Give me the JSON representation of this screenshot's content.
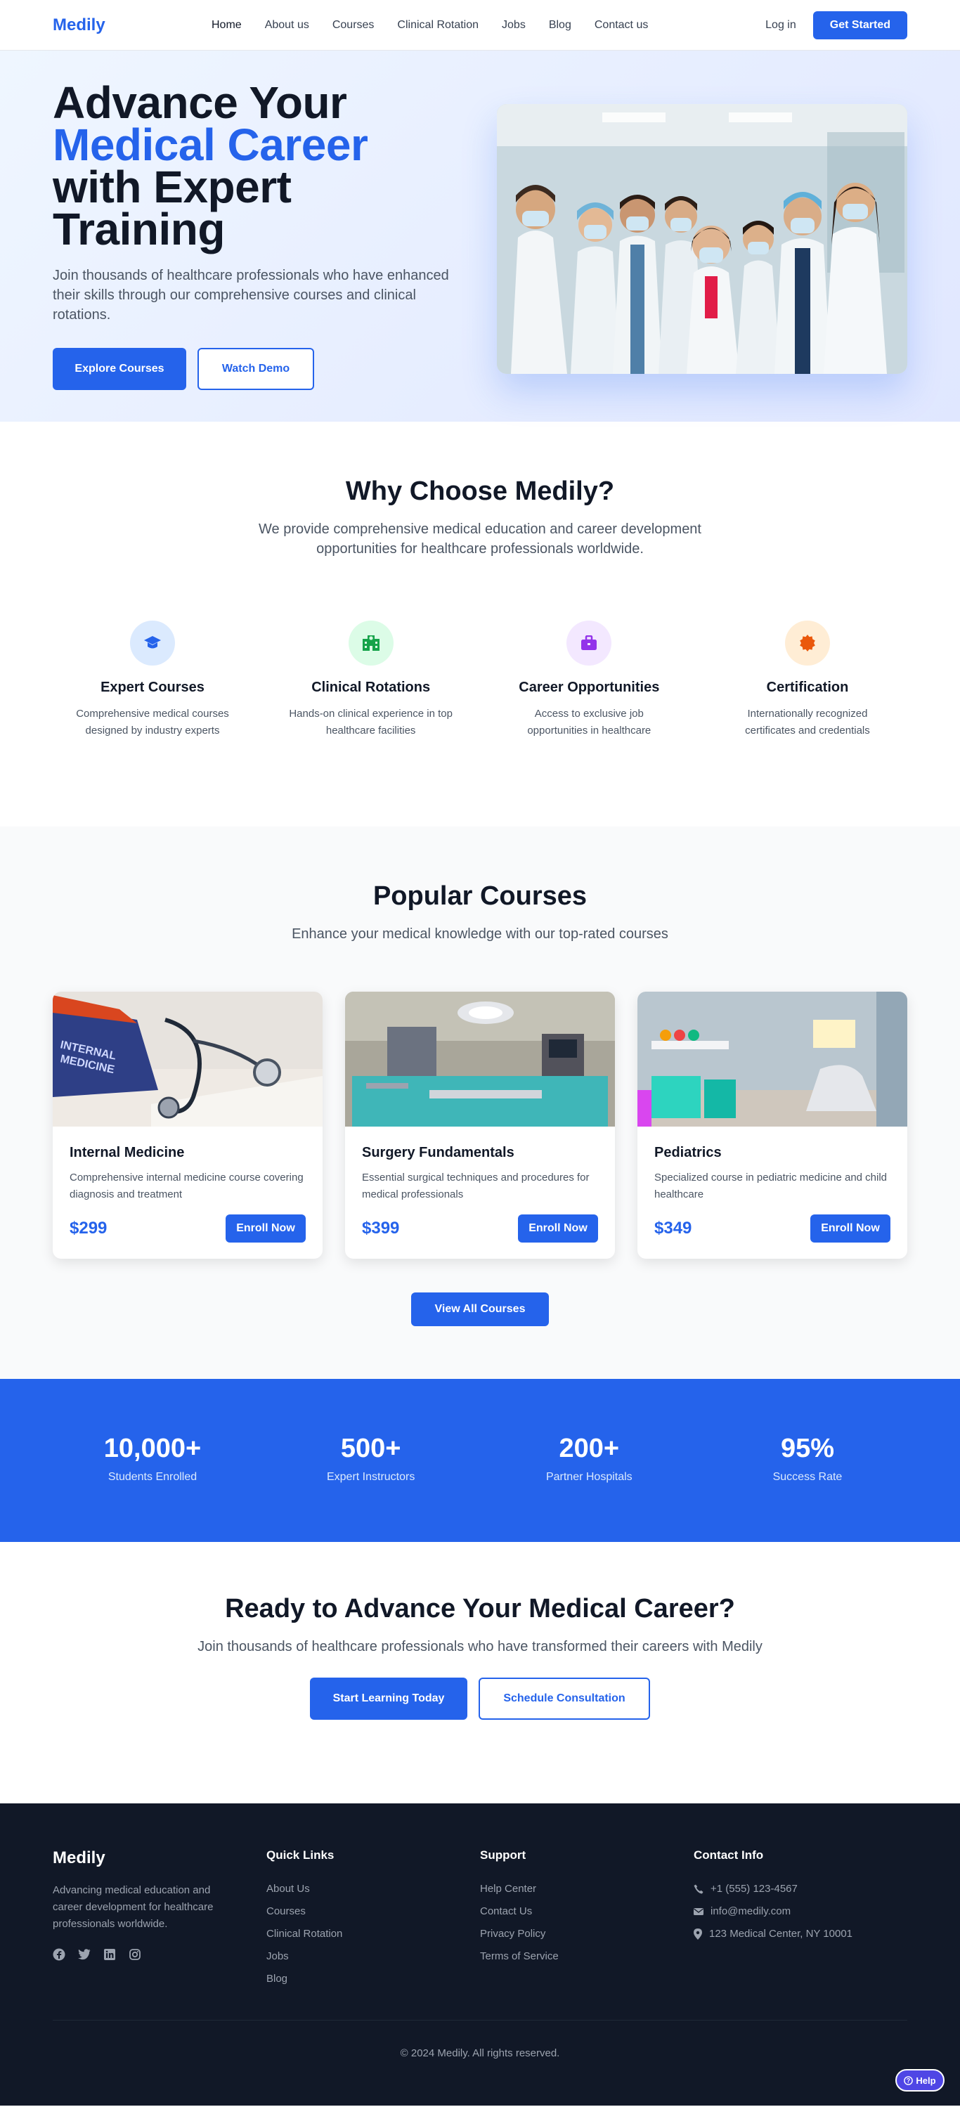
{
  "nav": {
    "logo": "Medily",
    "links": [
      "Home",
      "About us",
      "Courses",
      "Clinical Rotation",
      "Jobs",
      "Blog",
      "Contact us"
    ],
    "login": "Log in",
    "cta": "Get Started"
  },
  "hero": {
    "title_line1": "Advance Your",
    "title_accent": "Medical Career",
    "title_line2": "with Expert",
    "title_line3": "Training",
    "subtitle": "Join thousands of healthcare professionals who have enhanced their skills through our comprehensive courses and clinical rotations.",
    "primary_button": "Explore Courses",
    "secondary_button": "Watch Demo"
  },
  "why": {
    "title": "Why Choose Medily?",
    "subtitle": "We provide comprehensive medical education and career development opportunities for healthcare professionals worldwide.",
    "features": [
      {
        "icon": "graduation-cap-icon",
        "title": "Expert Courses",
        "desc": "Comprehensive medical courses designed by industry experts",
        "color": "#2563eb",
        "bg": "#dbeafe"
      },
      {
        "icon": "hospital-icon",
        "title": "Clinical Rotations",
        "desc": "Hands-on clinical experience in top healthcare facilities",
        "color": "#16a34a",
        "bg": "#dcfce7"
      },
      {
        "icon": "briefcase-icon",
        "title": "Career Opportunities",
        "desc": "Access to exclusive job opportunities in healthcare",
        "color": "#9333ea",
        "bg": "#f3e8ff"
      },
      {
        "icon": "certificate-icon",
        "title": "Certification",
        "desc": "Internationally recognized certificates and credentials",
        "color": "#ea580c",
        "bg": "#ffedd5"
      }
    ]
  },
  "courses": {
    "title": "Popular Courses",
    "subtitle": "Enhance your medical knowledge with our top-rated courses",
    "items": [
      {
        "title": "Internal Medicine",
        "desc": "Comprehensive internal medicine course covering diagnosis and treatment",
        "price": "$299",
        "button": "Enroll Now"
      },
      {
        "title": "Surgery Fundamentals",
        "desc": "Essential surgical techniques and procedures for medical professionals",
        "price": "$399",
        "button": "Enroll Now"
      },
      {
        "title": "Pediatrics",
        "desc": "Specialized course in pediatric medicine and child healthcare",
        "price": "$349",
        "button": "Enroll Now"
      }
    ],
    "view_all": "View All Courses"
  },
  "stats": [
    {
      "value": "10,000+",
      "label": "Students Enrolled"
    },
    {
      "value": "500+",
      "label": "Expert Instructors"
    },
    {
      "value": "200+",
      "label": "Partner Hospitals"
    },
    {
      "value": "95%",
      "label": "Success Rate"
    }
  ],
  "cta": {
    "title": "Ready to Advance Your Medical Career?",
    "subtitle": "Join thousands of healthcare professionals who have transformed their careers with Medily",
    "primary_button": "Start Learning Today",
    "secondary_button": "Schedule Consultation"
  },
  "footer": {
    "logo": "Medily",
    "about": "Advancing medical education and career development for healthcare professionals worldwide.",
    "socials": [
      "facebook-icon",
      "twitter-icon",
      "linkedin-icon",
      "instagram-icon"
    ],
    "quick_links_title": "Quick Links",
    "quick_links": [
      "About Us",
      "Courses",
      "Clinical Rotation",
      "Jobs",
      "Blog"
    ],
    "support_title": "Support",
    "support_links": [
      "Help Center",
      "Contact Us",
      "Privacy Policy",
      "Terms of Service"
    ],
    "contact_title": "Contact Info",
    "phone": "+1 (555) 123-4567",
    "email": "info@medily.com",
    "address": "123 Medical Center, NY 10001",
    "copyright": "© 2024 Medily. All rights reserved."
  },
  "help_button": "Help",
  "colors": {
    "brand": "#2563eb",
    "dark": "#111827",
    "help": "#4f46e5"
  }
}
